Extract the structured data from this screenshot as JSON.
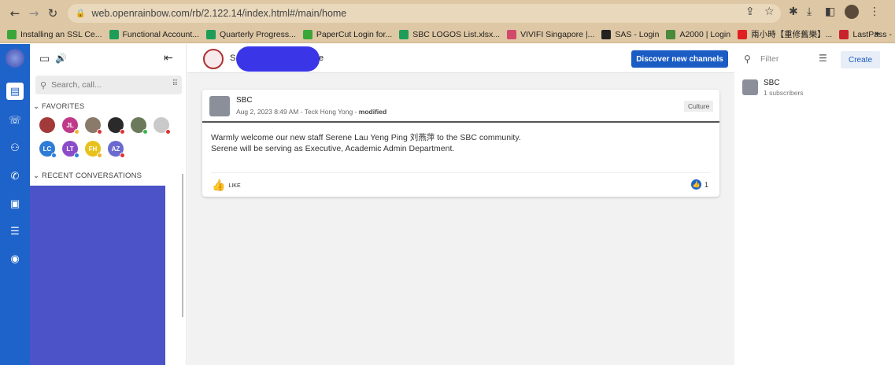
{
  "browser": {
    "url": "web.openrainbow.com/rb/2.122.14/index.html#/main/home",
    "bookmarks": [
      {
        "label": "Installing an SSL Ce...",
        "icon": "papercut-icon",
        "color": "#3aa63a"
      },
      {
        "label": "Functional Account...",
        "icon": "sheets-icon",
        "color": "#1e9d58"
      },
      {
        "label": "Quarterly Progress...",
        "icon": "sheets-icon",
        "color": "#1e9d58"
      },
      {
        "label": "PaperCut Login for...",
        "icon": "papercut-icon",
        "color": "#3aa63a"
      },
      {
        "label": "SBC LOGOS List.xlsx...",
        "icon": "sheets-icon",
        "color": "#1e9d58"
      },
      {
        "label": "VIVIFI Singapore |...",
        "icon": "vivifi-icon",
        "color": "#d04a6a"
      },
      {
        "label": "SAS - Login",
        "icon": "sas-icon",
        "color": "#222222"
      },
      {
        "label": "A2000 | Login",
        "icon": "a2000-icon",
        "color": "#4a8a3a"
      },
      {
        "label": "兩小時【重修舊樂】...",
        "icon": "youtube-icon",
        "color": "#e02020"
      },
      {
        "label": "LastPass -",
        "icon": "lastpass-icon",
        "color": "#c8232c"
      }
    ],
    "more_label": "»"
  },
  "sidebar": {
    "search_placeholder": "Search, call...",
    "favorites_title": "FAVORITES",
    "recent_title": "RECENT CONVERSATIONS",
    "favorites": [
      {
        "initials": "",
        "color": "#a23a3a",
        "status": ""
      },
      {
        "initials": "JL",
        "color": "#c03a8a",
        "status": "#f3b52a"
      },
      {
        "initials": "",
        "color": "#8a7a6a",
        "status": "#d33"
      },
      {
        "initials": "",
        "color": "#2a2a2a",
        "status": "#d33"
      },
      {
        "initials": "",
        "color": "#6a7a5a",
        "status": "#3bb54a"
      },
      {
        "initials": "",
        "color": "#c9c9c9",
        "status": "#d33"
      },
      {
        "initials": "LC",
        "color": "#2e7cd6",
        "status": "#2e7cd6"
      },
      {
        "initials": "LT",
        "color": "#8a4cc8",
        "status": "#2e7cd6"
      },
      {
        "initials": "FH",
        "color": "#e8c21a",
        "status": "#f3b52a"
      },
      {
        "initials": "AZ",
        "color": "#6a6ad0",
        "status": "#d33"
      }
    ]
  },
  "channel_header": {
    "name": "S",
    "name_tail": "e",
    "discover_label": "Discover new channels"
  },
  "post": {
    "channel": "SBC",
    "meta_prefix": "Aug 2, 2023 8:49 AM - Teck Hong Yong - ",
    "meta_modified": "modified",
    "tag": "Culture",
    "line1": "Warmly welcome our new staff Serene Lau Yeng Ping 刘燕萍 to the SBC community.",
    "line2": "Serene will be serving as Executive, Academic Admin Department.",
    "like_label": "LIKE",
    "like_count": "1"
  },
  "right_panel": {
    "filter_placeholder": "Filter",
    "create_label": "Create",
    "channel_name": "SBC",
    "channel_subscribers": "1 subscribers"
  }
}
